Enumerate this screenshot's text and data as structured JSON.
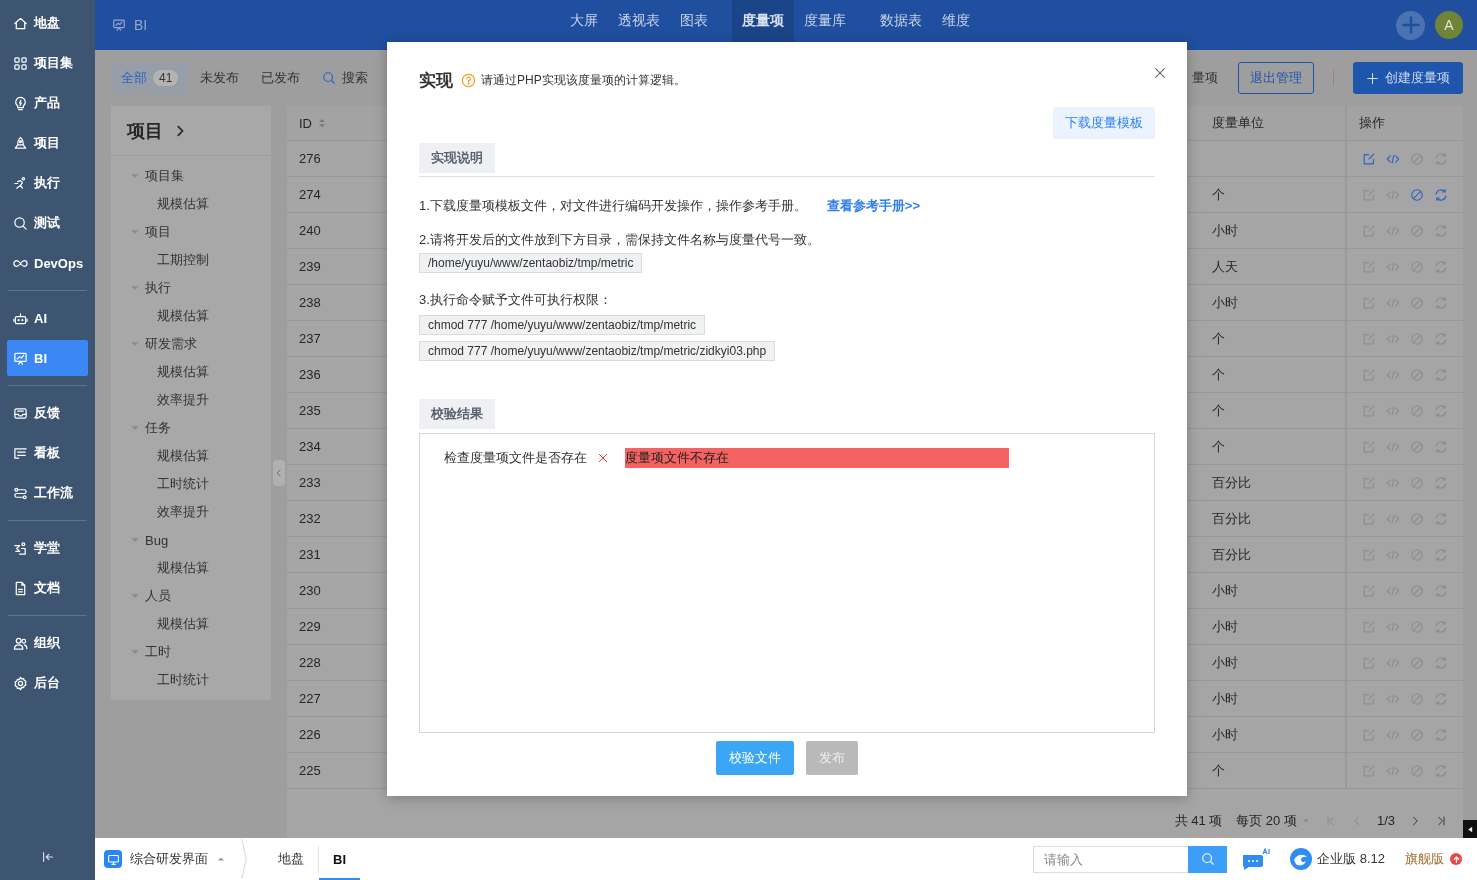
{
  "sidebar": {
    "groups": [
      {
        "items": [
          {
            "label": "地盘",
            "selected": false
          },
          {
            "label": "项目集",
            "selected": false
          },
          {
            "label": "产品",
            "selected": false
          },
          {
            "label": "项目",
            "selected": false
          },
          {
            "label": "执行",
            "selected": false
          },
          {
            "label": "测试",
            "selected": false
          },
          {
            "label": "DevOps",
            "selected": false
          }
        ]
      },
      {
        "items": [
          {
            "label": "AI",
            "selected": false
          },
          {
            "label": "BI",
            "selected": true
          }
        ]
      },
      {
        "items": [
          {
            "label": "反馈",
            "selected": false
          },
          {
            "label": "看板",
            "selected": false
          },
          {
            "label": "工作流",
            "selected": false
          }
        ]
      },
      {
        "items": [
          {
            "label": "学堂",
            "selected": false
          },
          {
            "label": "文档",
            "selected": false
          }
        ]
      },
      {
        "items": [
          {
            "label": "组织",
            "selected": false
          },
          {
            "label": "后台",
            "selected": false
          }
        ]
      }
    ]
  },
  "header": {
    "title": "BI",
    "nav_groups": [
      [
        {
          "label": "大屏",
          "selected": false
        },
        {
          "label": "透视表",
          "selected": false
        },
        {
          "label": "图表",
          "selected": false
        }
      ],
      [
        {
          "label": "度量项",
          "selected": true
        },
        {
          "label": "度量库",
          "selected": false
        }
      ],
      [
        {
          "label": "数据表",
          "selected": false
        },
        {
          "label": "维度",
          "selected": false
        }
      ]
    ],
    "avatar": "A"
  },
  "toolbar": {
    "filters": [
      {
        "label": "全部",
        "count": "41",
        "selected": true
      },
      {
        "label": "未发布",
        "selected": false
      },
      {
        "label": "已发布",
        "selected": false
      }
    ],
    "search": "搜索",
    "cut_label": "量项",
    "exit_button": "退出管理",
    "create_button": "创建度量项"
  },
  "tree": {
    "title": "项目",
    "groups": [
      {
        "label": "项目集",
        "expanded": true,
        "children": [
          {
            "label": "规模估算"
          }
        ]
      },
      {
        "label": "项目",
        "expanded": true,
        "children": [
          {
            "label": "工期控制"
          }
        ]
      },
      {
        "label": "执行",
        "expanded": true,
        "children": [
          {
            "label": "规模估算"
          }
        ]
      },
      {
        "label": "研发需求",
        "expanded": true,
        "children": [
          {
            "label": "规模估算"
          },
          {
            "label": "效率提升"
          }
        ]
      },
      {
        "label": "任务",
        "expanded": true,
        "children": [
          {
            "label": "规模估算"
          },
          {
            "label": "工时统计"
          },
          {
            "label": "效率提升"
          }
        ]
      },
      {
        "label": "Bug",
        "expanded": true,
        "children": [
          {
            "label": "规模估算"
          }
        ]
      },
      {
        "label": "人员",
        "expanded": true,
        "children": [
          {
            "label": "规模估算"
          }
        ]
      },
      {
        "label": "工时",
        "expanded": true,
        "children": [
          {
            "label": "工时统计"
          }
        ]
      }
    ]
  },
  "table": {
    "columns": [
      "ID",
      "度量单位",
      "操作"
    ],
    "rows": [
      {
        "id": "276",
        "actions": [
          {
            "kind": "edit",
            "enabled": true
          },
          {
            "kind": "code",
            "enabled": true
          },
          {
            "kind": "disable",
            "enabled": false
          },
          {
            "kind": "refresh",
            "enabled": false
          }
        ]
      },
      {
        "id": "274",
        "unit": "个",
        "actions": [
          {
            "kind": "edit",
            "enabled": false
          },
          {
            "kind": "code",
            "enabled": false
          },
          {
            "kind": "disable",
            "enabled": true
          },
          {
            "kind": "refresh",
            "enabled": true
          }
        ]
      },
      {
        "id": "240",
        "unit": "小时",
        "actions": [
          {
            "kind": "edit",
            "enabled": false
          },
          {
            "kind": "code",
            "enabled": false
          },
          {
            "kind": "disable",
            "enabled": false
          },
          {
            "kind": "refresh",
            "enabled": false
          }
        ]
      },
      {
        "id": "239",
        "unit": "人天",
        "actions": [
          {
            "kind": "edit",
            "enabled": false
          },
          {
            "kind": "code",
            "enabled": false
          },
          {
            "kind": "disable",
            "enabled": false
          },
          {
            "kind": "refresh",
            "enabled": false
          }
        ]
      },
      {
        "id": "238",
        "unit": "小时",
        "actions": [
          {
            "kind": "edit",
            "enabled": false
          },
          {
            "kind": "code",
            "enabled": false
          },
          {
            "kind": "disable",
            "enabled": false
          },
          {
            "kind": "refresh",
            "enabled": false
          }
        ]
      },
      {
        "id": "237",
        "unit": "个",
        "actions": [
          {
            "kind": "edit",
            "enabled": false
          },
          {
            "kind": "code",
            "enabled": false
          },
          {
            "kind": "disable",
            "enabled": false
          },
          {
            "kind": "refresh",
            "enabled": false
          }
        ]
      },
      {
        "id": "236",
        "unit": "个",
        "actions": [
          {
            "kind": "edit",
            "enabled": false
          },
          {
            "kind": "code",
            "enabled": false
          },
          {
            "kind": "disable",
            "enabled": false
          },
          {
            "kind": "refresh",
            "enabled": false
          }
        ]
      },
      {
        "id": "235",
        "unit": "个",
        "actions": [
          {
            "kind": "edit",
            "enabled": false
          },
          {
            "kind": "code",
            "enabled": false
          },
          {
            "kind": "disable",
            "enabled": false
          },
          {
            "kind": "refresh",
            "enabled": false
          }
        ]
      },
      {
        "id": "234",
        "unit": "个",
        "actions": [
          {
            "kind": "edit",
            "enabled": false
          },
          {
            "kind": "code",
            "enabled": false
          },
          {
            "kind": "disable",
            "enabled": false
          },
          {
            "kind": "refresh",
            "enabled": false
          }
        ]
      },
      {
        "id": "233",
        "unit": "百分比",
        "actions": [
          {
            "kind": "edit",
            "enabled": false
          },
          {
            "kind": "code",
            "enabled": false
          },
          {
            "kind": "disable",
            "enabled": false
          },
          {
            "kind": "refresh",
            "enabled": false
          }
        ]
      },
      {
        "id": "232",
        "unit": "百分比",
        "actions": [
          {
            "kind": "edit",
            "enabled": false
          },
          {
            "kind": "code",
            "enabled": false
          },
          {
            "kind": "disable",
            "enabled": false
          },
          {
            "kind": "refresh",
            "enabled": false
          }
        ]
      },
      {
        "id": "231",
        "unit": "百分比",
        "actions": [
          {
            "kind": "edit",
            "enabled": false
          },
          {
            "kind": "code",
            "enabled": false
          },
          {
            "kind": "disable",
            "enabled": false
          },
          {
            "kind": "refresh",
            "enabled": false
          }
        ]
      },
      {
        "id": "230",
        "unit": "小时",
        "actions": [
          {
            "kind": "edit",
            "enabled": false
          },
          {
            "kind": "code",
            "enabled": false
          },
          {
            "kind": "disable",
            "enabled": false
          },
          {
            "kind": "refresh",
            "enabled": false
          }
        ]
      },
      {
        "id": "229",
        "unit": "小时",
        "actions": [
          {
            "kind": "edit",
            "enabled": false
          },
          {
            "kind": "code",
            "enabled": false
          },
          {
            "kind": "disable",
            "enabled": false
          },
          {
            "kind": "refresh",
            "enabled": false
          }
        ]
      },
      {
        "id": "228",
        "unit": "小时",
        "actions": [
          {
            "kind": "edit",
            "enabled": false
          },
          {
            "kind": "code",
            "enabled": false
          },
          {
            "kind": "disable",
            "enabled": false
          },
          {
            "kind": "refresh",
            "enabled": false
          }
        ]
      },
      {
        "id": "227",
        "unit": "小时",
        "actions": [
          {
            "kind": "edit",
            "enabled": false
          },
          {
            "kind": "code",
            "enabled": false
          },
          {
            "kind": "disable",
            "enabled": false
          },
          {
            "kind": "refresh",
            "enabled": false
          }
        ]
      },
      {
        "id": "226",
        "unit": "小时",
        "actions": [
          {
            "kind": "edit",
            "enabled": false
          },
          {
            "kind": "code",
            "enabled": false
          },
          {
            "kind": "disable",
            "enabled": false
          },
          {
            "kind": "refresh",
            "enabled": false
          }
        ]
      },
      {
        "id": "225",
        "unit": "个",
        "actions": [
          {
            "kind": "edit",
            "enabled": false
          },
          {
            "kind": "code",
            "enabled": false
          },
          {
            "kind": "disable",
            "enabled": false
          },
          {
            "kind": "refresh",
            "enabled": false
          }
        ]
      }
    ]
  },
  "pagination": {
    "total": "共 41 项",
    "page_size": "每页 20 项",
    "page": "1/3"
  },
  "dialog": {
    "title": "实现",
    "hint": "请通过PHP实现该度量项的计算逻辑。",
    "download_button": "下载度量模板",
    "instructions_title": "实现说明",
    "steps": [
      {
        "text": "1.下载度量项模板文件，对文件进行编码开发操作，操作参考手册。",
        "link": "查看参考手册>>"
      },
      {
        "text": "2.请将开发后的文件放到下方目录，需保持文件名称与度量代号一致。",
        "codes": [
          "/home/yuyu/www/zentaobiz/tmp/metric"
        ]
      },
      {
        "text": "3.执行命令赋予文件可执行权限：",
        "codes": [
          "chmod 777 /home/yuyu/www/zentaobiz/tmp/metric",
          "chmod 777 /home/yuyu/www/zentaobiz/tmp/metric/zidkyi03.php"
        ]
      }
    ],
    "result_title": "校验结果",
    "checks": [
      {
        "label": "检查度量项文件是否存在",
        "passed": false,
        "message": "度量项文件不存在"
      }
    ],
    "buttons": [
      {
        "label": "校验文件",
        "disabled": false
      },
      {
        "label": "发布",
        "disabled": true
      }
    ]
  },
  "taskbar": {
    "app": "综合研发界面",
    "tabs": [
      {
        "label": "地盘",
        "selected": false
      },
      {
        "label": "BI",
        "selected": true
      }
    ],
    "search_placeholder": "请输入",
    "version": "企业版 8.12",
    "edition": "旗舰版"
  }
}
